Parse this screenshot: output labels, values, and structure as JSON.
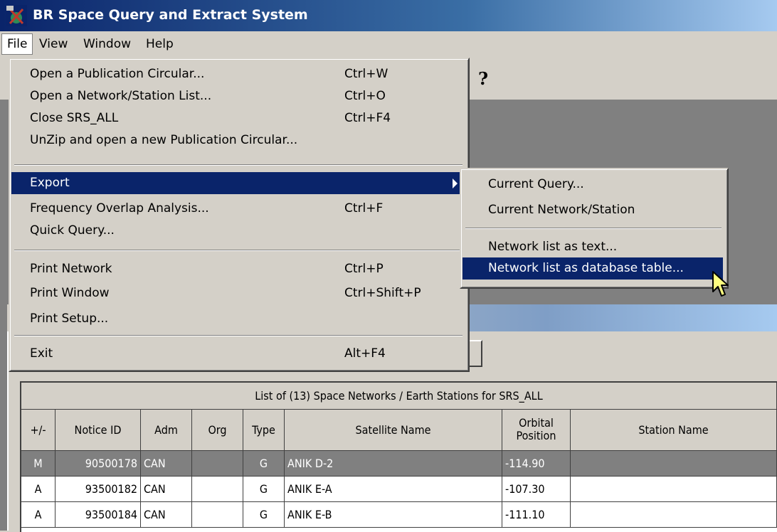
{
  "window": {
    "title": "BR Space Query and Extract System"
  },
  "menubar": [
    "File",
    "View",
    "Window",
    "Help"
  ],
  "file_menu": {
    "group1": [
      {
        "label": "Open a Publication Circular...",
        "shortcut": "Ctrl+W"
      },
      {
        "label": "Open a Network/Station List...",
        "shortcut": "Ctrl+O"
      },
      {
        "label": "Close SRS_ALL",
        "shortcut": "Ctrl+F4"
      },
      {
        "label": "UnZip and open a new Publication Circular...",
        "shortcut": ""
      }
    ],
    "group2": [
      {
        "label": "Export",
        "shortcut": ""
      },
      {
        "label": "Frequency Overlap Analysis...",
        "shortcut": "Ctrl+F"
      },
      {
        "label": "Quick Query...",
        "shortcut": ""
      }
    ],
    "group3": [
      {
        "label": "Print Network",
        "shortcut": "Ctrl+P"
      },
      {
        "label": "Print Window",
        "shortcut": "Ctrl+Shift+P"
      },
      {
        "label": "Print Setup...",
        "shortcut": ""
      }
    ],
    "group4": [
      {
        "label": "Exit",
        "shortcut": "Alt+F4"
      }
    ]
  },
  "export_submenu": {
    "group1": [
      "Current Query...",
      "Current Network/Station"
    ],
    "group2": [
      "Network list as text...",
      "Network list as database table..."
    ]
  },
  "toolbar": {
    "help_glyph": "?"
  },
  "table": {
    "caption": "List of (13) Space Networks / Earth Stations for SRS_ALL",
    "headers": [
      "+/-",
      "Notice ID",
      "Adm",
      "Org",
      "Type",
      "Satellite Name",
      "Orbital Position",
      "Station Name"
    ],
    "rows": [
      [
        "M",
        "90500178",
        "CAN",
        "",
        "G",
        "ANIK D-2",
        "-114.90",
        ""
      ],
      [
        "A",
        "93500182",
        "CAN",
        "",
        "G",
        "ANIK E-A",
        "-107.30",
        ""
      ],
      [
        "A",
        "93500184",
        "CAN",
        "",
        "G",
        "ANIK E-B",
        "-111.10",
        ""
      ]
    ]
  },
  "colors": {
    "highlight": "#0a246a",
    "face": "#d4d0c8",
    "mdi": "#808080"
  }
}
